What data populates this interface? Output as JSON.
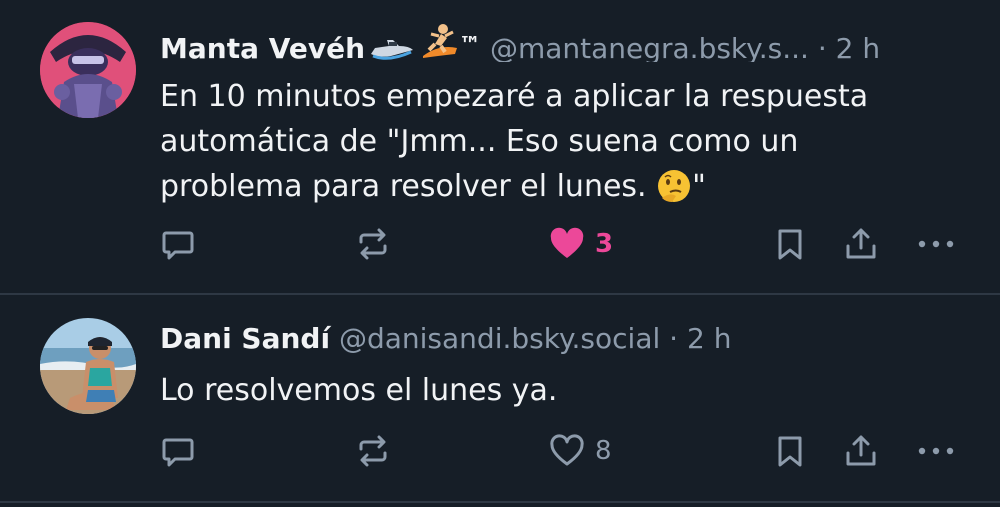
{
  "posts": [
    {
      "author_name": "Manta Vevéh",
      "author_badges": "™",
      "handle": "@mantanegra.bsky.s...",
      "separator": "·",
      "time": "2 h",
      "text_main": "En 10 minutos empezaré a aplicar la respuesta automática de \"Jmm... Eso suena como un problema para resolver el lunes. ",
      "text_end": "\"",
      "like_count": "3",
      "liked": true,
      "icons": [
        "jetski-icon",
        "surfer-icon",
        "thinking-face-emoji"
      ]
    },
    {
      "author_name": "Dani Sandí",
      "handle": "@danisandi.bsky.social",
      "separator": "·",
      "time": "2 h",
      "text_main": "Lo resolvemos el lunes ya.",
      "like_count": "8",
      "liked": false
    }
  ],
  "colors": {
    "background": "#161e27",
    "text": "#f1f3f5",
    "muted": "#8d9bab",
    "like_active": "#ec4899",
    "divider": "#2e3844"
  }
}
